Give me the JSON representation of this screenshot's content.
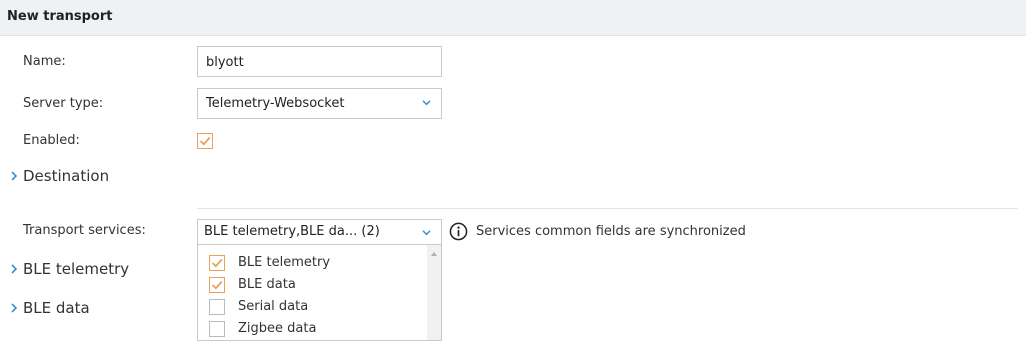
{
  "header": {
    "title": "New transport"
  },
  "form": {
    "name_label": "Name:",
    "name_value": "blyott",
    "server_type_label": "Server type:",
    "server_type_value": "Telemetry-Websocket",
    "enabled_label": "Enabled:",
    "enabled_checked": true
  },
  "sections": {
    "destination": "Destination",
    "ble_telemetry": "BLE telemetry",
    "ble_data": "BLE data"
  },
  "services": {
    "label": "Transport services:",
    "selected_summary": "BLE telemetry,BLE da... (2)",
    "info_text": "Services common fields are synchronized",
    "options": [
      {
        "label": "BLE telemetry",
        "checked": true
      },
      {
        "label": "BLE data",
        "checked": true
      },
      {
        "label": "Serial data",
        "checked": false
      },
      {
        "label": "Zigbee data",
        "checked": false
      }
    ]
  },
  "colors": {
    "accent_check": "#e8a25a",
    "chevron_blue": "#3d8fc9",
    "header_bg": "#f0f1f4"
  }
}
